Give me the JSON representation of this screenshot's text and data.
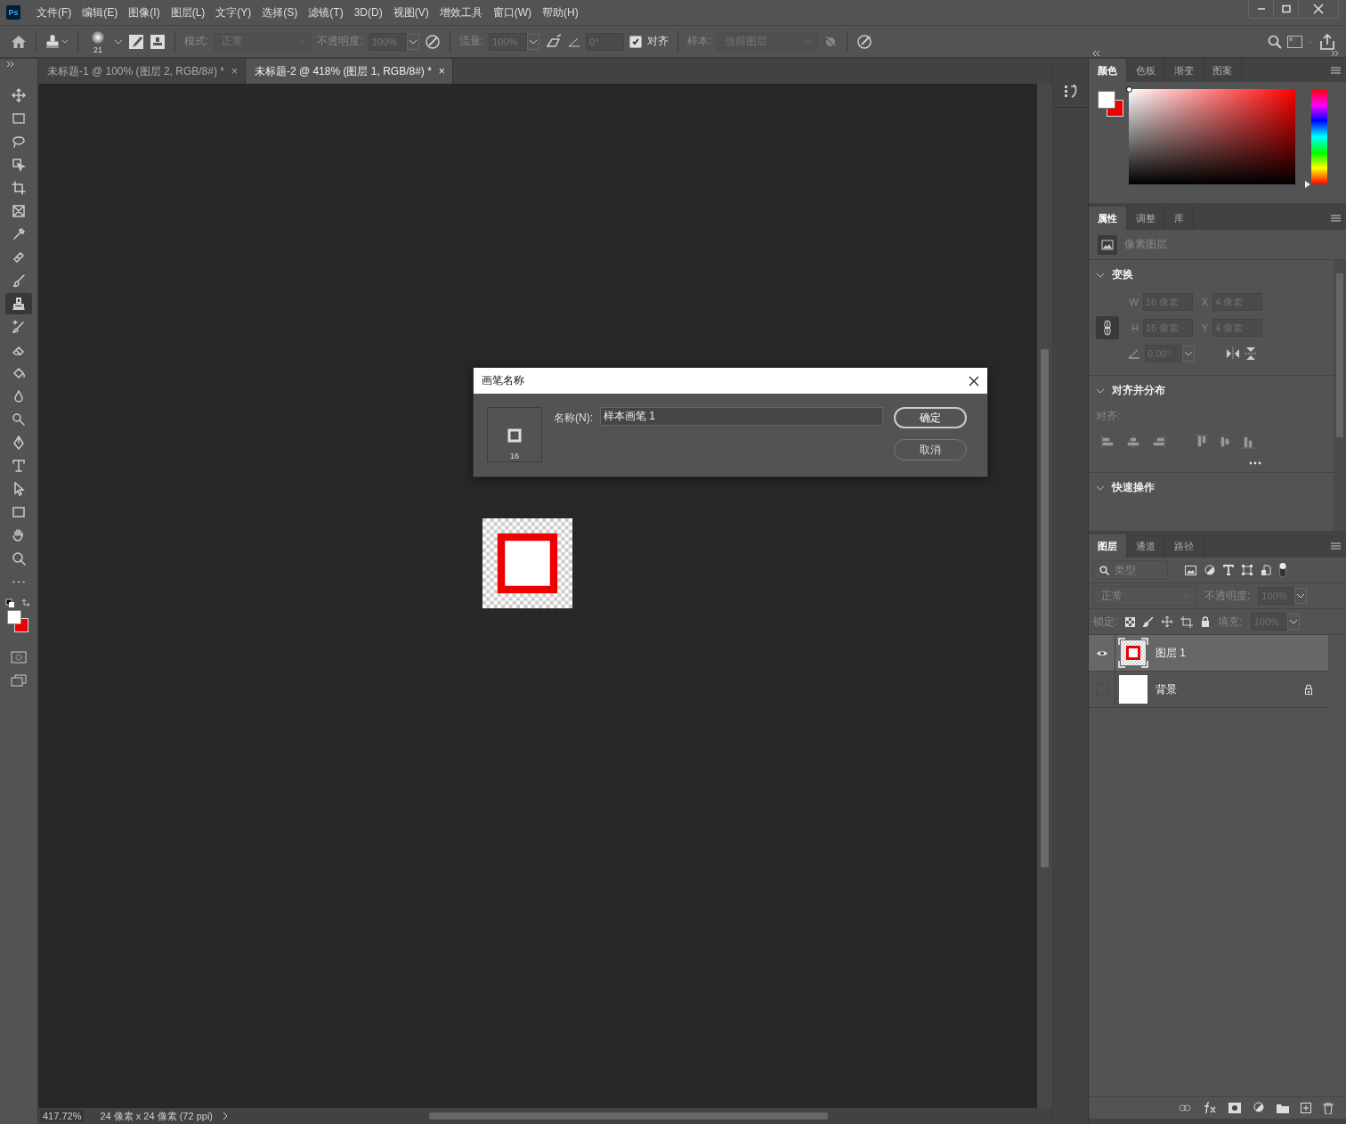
{
  "menu_bar": {
    "logo": "Ps",
    "items": [
      "文件(F)",
      "编辑(E)",
      "图像(I)",
      "图层(L)",
      "文字(Y)",
      "选择(S)",
      "滤镜(T)",
      "3D(D)",
      "视图(V)",
      "增效工具",
      "窗口(W)",
      "帮助(H)"
    ]
  },
  "options_bar": {
    "brush_size": "21",
    "mode_label": "模式:",
    "mode": "正常",
    "opacity_label": "不透明度:",
    "opacity": "100%",
    "flow_label": "流量:",
    "flow": "100%",
    "angle": "0°",
    "aligned": {
      "label": "对齐",
      "checked": true
    },
    "sample_label": "样本:",
    "sample": "当前图层"
  },
  "tabs": [
    {
      "label": "未标题-1 @ 100% (图层 2, RGB/8#) *",
      "close": "×",
      "selected": false
    },
    {
      "label": "未标题-2 @ 418% (图层 1, RGB/8#) *",
      "close": "×",
      "selected": true
    }
  ],
  "tools": [
    {
      "selected": false
    },
    {
      "selected": false
    },
    {
      "selected": false
    },
    {
      "selected": false
    },
    {
      "selected": false
    },
    {
      "selected": false
    },
    {
      "selected": false
    },
    {
      "selected": false
    },
    {
      "selected": false
    },
    {
      "selected": true
    },
    {
      "selected": false
    },
    {
      "selected": false
    },
    {
      "selected": false
    },
    {
      "selected": false
    },
    {
      "selected": false
    },
    {
      "selected": false
    },
    {
      "selected": false
    },
    {
      "selected": false
    },
    {
      "selected": false
    },
    {
      "selected": false
    },
    {
      "selected": false
    },
    {
      "selected": false
    }
  ],
  "dialog": {
    "title": "画笔名称",
    "brush_size": "16",
    "name_label": "名称(N):",
    "name_value": "样本画笔 1",
    "buttons": [
      {
        "label": "确定",
        "default": true
      },
      {
        "label": "取消",
        "default": false
      }
    ]
  },
  "status_bar": {
    "zoom": "417.72%",
    "info": "24 像素 x 24 像素 (72 ppi)"
  },
  "color_panel": {
    "tabs": [
      {
        "label": "颜色",
        "selected": true
      },
      {
        "label": "色板",
        "selected": false
      },
      {
        "label": "渐变",
        "selected": false
      },
      {
        "label": "图案",
        "selected": false
      }
    ]
  },
  "properties_panel": {
    "tabs": [
      {
        "label": "属性",
        "selected": true
      },
      {
        "label": "调整",
        "selected": false
      },
      {
        "label": "库",
        "selected": false
      }
    ],
    "layer_type": "像素图层",
    "transform": {
      "title": "变换",
      "w_label": "W",
      "w": "16 像素",
      "x_label": "X",
      "x": "4 像素",
      "h_label": "H",
      "h": "16 像素",
      "y_label": "Y",
      "y": "4 像素",
      "angle": "0.00°"
    },
    "align": {
      "title": "对齐并分布",
      "label": "对齐:"
    },
    "quick_actions": {
      "title": "快速操作"
    }
  },
  "layers_panel": {
    "tabs": [
      {
        "label": "图层",
        "selected": true
      },
      {
        "label": "通道",
        "selected": false
      },
      {
        "label": "路径",
        "selected": false
      }
    ],
    "filter_placeholder": "类型",
    "blend_mode": "正常",
    "opacity_label": "不透明度:",
    "opacity": "100%",
    "lock_label": "锁定:",
    "fill_label": "填充:",
    "fill": "100%",
    "layers": [
      {
        "name": "图层 1",
        "visible": true,
        "selected": true,
        "locked": false,
        "kind": "pixel"
      },
      {
        "name": "背景",
        "visible": false,
        "selected": false,
        "locked": true,
        "kind": "background"
      }
    ]
  }
}
